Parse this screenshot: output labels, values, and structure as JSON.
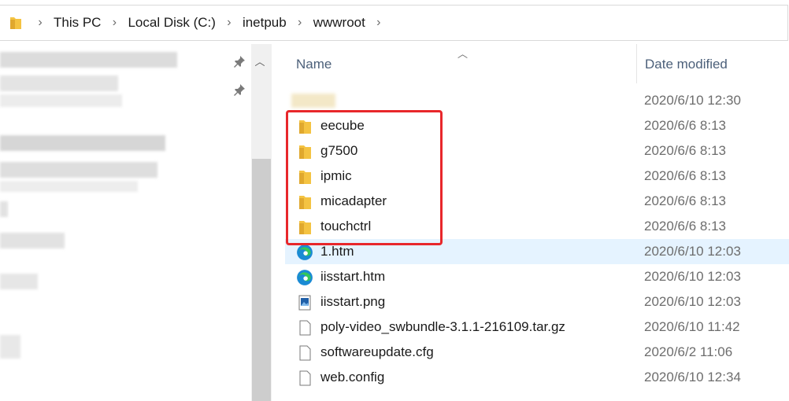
{
  "breadcrumb": {
    "items": [
      "This PC",
      "Local Disk (C:)",
      "inetpub",
      "wwwroot"
    ]
  },
  "columns": {
    "name": "Name",
    "date_modified": "Date modified"
  },
  "files": [
    {
      "name": "",
      "date": "2020/6/10 12:30",
      "type": "folder-blurred"
    },
    {
      "name": "eecube",
      "date": "2020/6/6 8:13",
      "type": "folder"
    },
    {
      "name": "g7500",
      "date": "2020/6/6 8:13",
      "type": "folder"
    },
    {
      "name": "ipmic",
      "date": "2020/6/6 8:13",
      "type": "folder"
    },
    {
      "name": "micadapter",
      "date": "2020/6/6 8:13",
      "type": "folder"
    },
    {
      "name": "touchctrl",
      "date": "2020/6/6 8:13",
      "type": "folder"
    },
    {
      "name": "1.htm",
      "date": "2020/6/10 12:03",
      "type": "edge-html",
      "selected": true
    },
    {
      "name": "iisstart.htm",
      "date": "2020/6/10 12:03",
      "type": "edge-html"
    },
    {
      "name": "iisstart.png",
      "date": "2020/6/10 12:03",
      "type": "image"
    },
    {
      "name": "poly-video_swbundle-3.1.1-216109.tar.gz",
      "date": "2020/6/10 11:42",
      "type": "file"
    },
    {
      "name": "softwareupdate.cfg",
      "date": "2020/6/2 11:06",
      "type": "file"
    },
    {
      "name": "web.config",
      "date": "2020/6/10 12:34",
      "type": "file"
    }
  ],
  "colors": {
    "highlight": "#e8272b",
    "selection": "#e5f3ff",
    "folder": "#f4c342"
  }
}
